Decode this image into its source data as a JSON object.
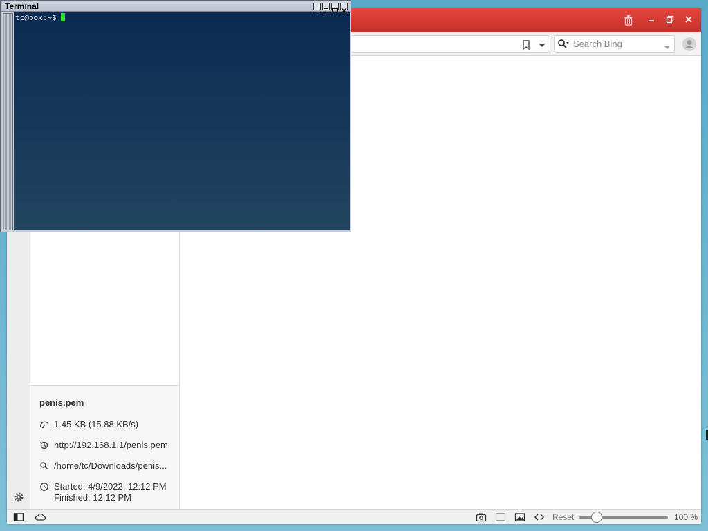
{
  "browser": {
    "search_placeholder": "Search Bing",
    "download": {
      "filename": "penis.pem",
      "size": "1.45 KB (15.88 KB/s)",
      "source_url": "http://192.168.1.1/penis.pem",
      "path": "/home/tc/Downloads/penis...",
      "started": "Started: 4/9/2022, 12:12 PM",
      "finished": "Finished: 12:12 PM"
    },
    "statusbar": {
      "reset_label": "Reset",
      "zoom_label": "100 %",
      "zoom_level": 100
    }
  },
  "terminal": {
    "title": "Terminal",
    "prompt": "tc@box:~$"
  },
  "colors": {
    "tabbar_accent": "#d63a33",
    "terminal_bg": "#0b2a52",
    "cursor": "#31e031"
  }
}
